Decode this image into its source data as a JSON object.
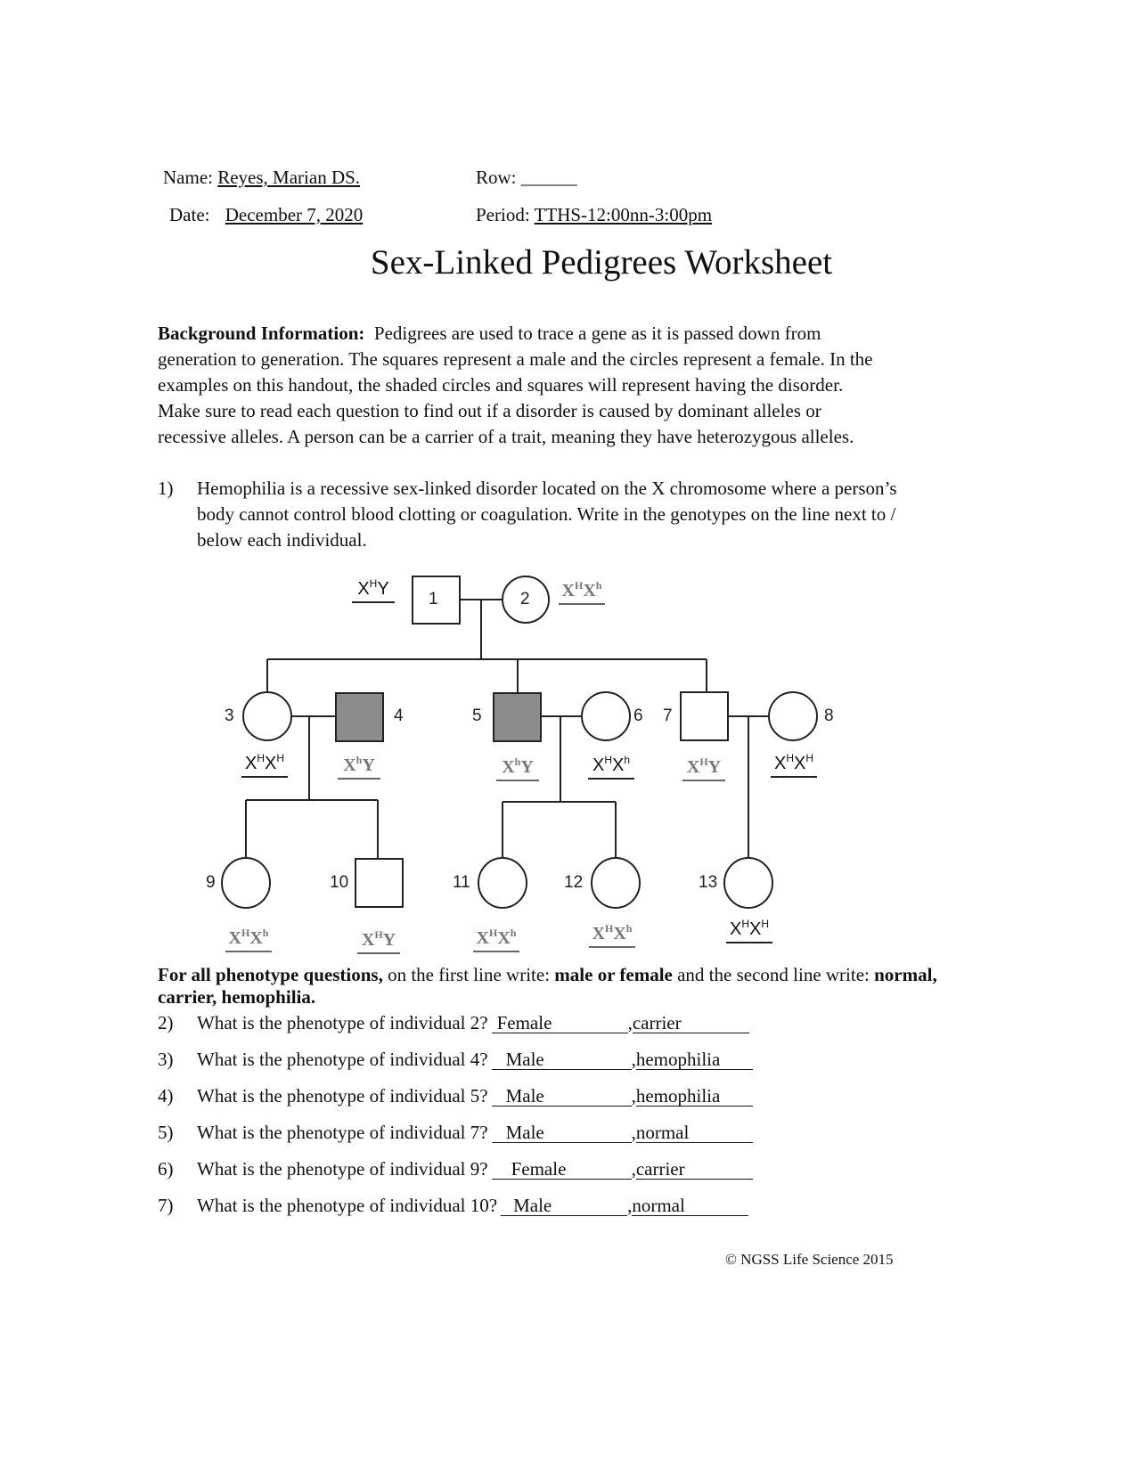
{
  "header": {
    "name_label": "Name:",
    "name_value": "Reyes, Marian DS.",
    "row_label": "Row:",
    "row_value": "______",
    "date_label": "Date:",
    "date_value": "December 7, 2020",
    "period_label": "Period:",
    "period_value": "TTHS-12:00nn-3:00pm"
  },
  "title": "Sex-Linked Pedigrees Worksheet",
  "background": {
    "label": "Background Information:",
    "lines": [
      "Pedigrees are used to trace a gene as it is passed down from",
      "generation to generation. The squares represent a male and the circles represent a female. In the",
      "examples on this handout, the shaded circles and squares will represent having the disorder.",
      "Make sure to read each question to find out if a disorder is caused by dominant alleles or",
      "recessive alleles. A person can be a carrier of a trait, meaning they have heterozygous alleles."
    ]
  },
  "question1": {
    "number": "1)",
    "lines": [
      "Hemophilia is a recessive sex-linked disorder located on the X chromosome where a person’s",
      "body cannot control blood clotting or coagulation. Write in the genotypes on the line next to /",
      "below each individual."
    ]
  },
  "pedigree": {
    "individuals": [
      {
        "id": "1",
        "sex": "male",
        "affected": false,
        "genotype": [
          "X",
          "H",
          "Y",
          ""
        ]
      },
      {
        "id": "2",
        "sex": "female",
        "affected": false,
        "genotype": [
          "X",
          "H",
          "X",
          "h"
        ]
      },
      {
        "id": "3",
        "sex": "female",
        "affected": false,
        "genotype": [
          "X",
          "H",
          "X",
          "H"
        ]
      },
      {
        "id": "4",
        "sex": "male",
        "affected": true,
        "genotype": [
          "X",
          "h",
          "Y",
          ""
        ]
      },
      {
        "id": "5",
        "sex": "male",
        "affected": true,
        "genotype": [
          "X",
          "h",
          "Y",
          ""
        ]
      },
      {
        "id": "6",
        "sex": "female",
        "affected": false,
        "genotype": [
          "X",
          "H",
          "X",
          "h"
        ]
      },
      {
        "id": "7",
        "sex": "male",
        "affected": false,
        "genotype": [
          "X",
          "H",
          "Y",
          ""
        ]
      },
      {
        "id": "8",
        "sex": "female",
        "affected": false,
        "genotype": [
          "X",
          "H",
          "X",
          "H"
        ]
      },
      {
        "id": "9",
        "sex": "female",
        "affected": false,
        "genotype": [
          "X",
          "H",
          "X",
          "h"
        ]
      },
      {
        "id": "10",
        "sex": "male",
        "affected": false,
        "genotype": [
          "X",
          "H",
          "Y",
          ""
        ]
      },
      {
        "id": "11",
        "sex": "female",
        "affected": false,
        "genotype": [
          "X",
          "H",
          "X",
          "h"
        ]
      },
      {
        "id": "12",
        "sex": "female",
        "affected": false,
        "genotype": [
          "X",
          "H",
          "X",
          "h"
        ]
      },
      {
        "id": "13",
        "sex": "female",
        "affected": false,
        "genotype": [
          "X",
          "H",
          "X",
          "H"
        ]
      }
    ]
  },
  "phenotype_instructions": {
    "bold1": "For all phenotype questions,",
    "text1": " on the first line write: ",
    "bold2": "male or female",
    "text2": " and the second line write: ",
    "bold3": "normal,",
    "bold4": "carrier, hemophilia."
  },
  "questions": [
    {
      "number": "2)",
      "text": "What is the phenotype of individual 2?",
      "sex": "Female",
      "status": "carrier"
    },
    {
      "number": "3)",
      "text": "What is the phenotype of individual 4?",
      "sex": "Male",
      "status": "hemophilia"
    },
    {
      "number": "4)",
      "text": "What is the phenotype of individual 5?",
      "sex": "Male",
      "status": "hemophilia"
    },
    {
      "number": "5)",
      "text": "What is the phenotype of individual 7?",
      "sex": "Male",
      "status": "normal"
    },
    {
      "number": "6)",
      "text": "What is the phenotype of individual 9?",
      "sex": "Female",
      "status": "carrier"
    },
    {
      "number": "7)",
      "text": "What is the phenotype of individual 10?",
      "sex": "Male",
      "status": "normal"
    }
  ],
  "footer": "© NGSS Life Science 2015",
  "colors": {
    "affected_fill": "#8c8c8c",
    "handwritten_gray": "#777777"
  }
}
